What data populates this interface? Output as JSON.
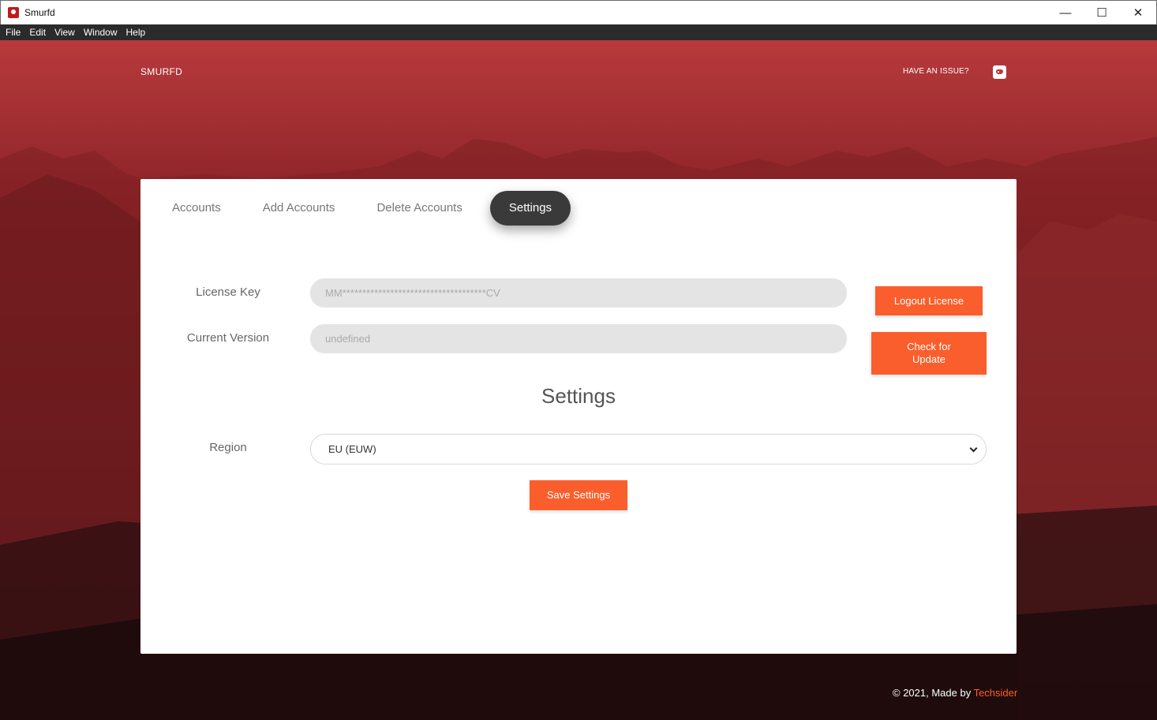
{
  "window": {
    "title": "Smurfd",
    "minimize": "—",
    "maximize": "☐",
    "close": "✕"
  },
  "menu": [
    "File",
    "Edit",
    "View",
    "Window",
    "Help"
  ],
  "header": {
    "brand": "SMURFD",
    "issue_link": "HAVE AN ISSUE?",
    "discord_icon": "discord-icon"
  },
  "tabs": [
    {
      "label": "Accounts",
      "active": false
    },
    {
      "label": "Add Accounts",
      "active": false
    },
    {
      "label": "Delete Accounts",
      "active": false
    },
    {
      "label": "Settings",
      "active": true
    }
  ],
  "license": {
    "label": "License Key",
    "value": "MM************************************CV",
    "logout_button": "Logout License"
  },
  "version": {
    "label": "Current Version",
    "value": "undefined",
    "update_button": "Check for Update"
  },
  "settings": {
    "title": "Settings",
    "region_label": "Region",
    "region_value": "EU (EUW)",
    "save_button": "Save Settings"
  },
  "footer": {
    "text": "© 2021, Made by ",
    "link": "Techsider"
  },
  "colors": {
    "accent": "#fa5e2c",
    "active_tab": "#3a3a3a"
  }
}
